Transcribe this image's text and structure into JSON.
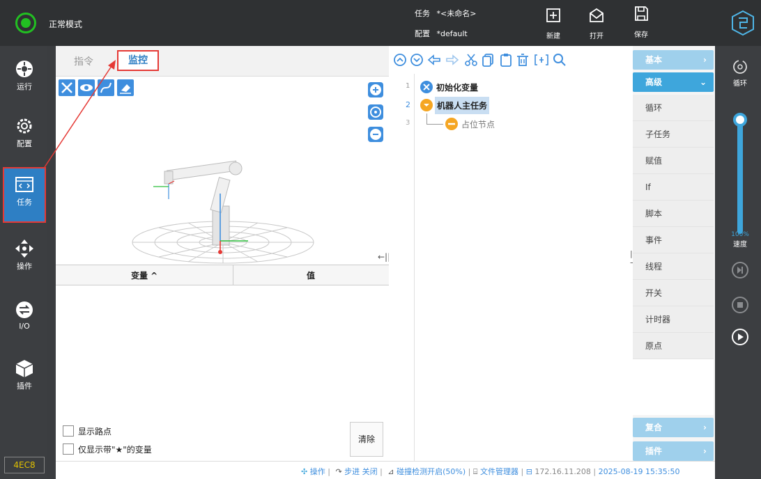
{
  "topbar": {
    "mode_label": "正常模式",
    "task_label": "任务",
    "task_name": "*<未命名>",
    "config_label": "配置",
    "config_name": "*default",
    "new_label": "新建",
    "open_label": "打开",
    "save_label": "保存"
  },
  "sidebar": {
    "items": [
      {
        "label": "运行"
      },
      {
        "label": "配置"
      },
      {
        "label": "任务"
      },
      {
        "label": "操作"
      },
      {
        "label": "I/O"
      },
      {
        "label": "插件"
      }
    ],
    "device_id": "4EC8"
  },
  "left_panel": {
    "tabs": [
      "指令",
      "监控"
    ],
    "var_table": {
      "col_variable": "变量 ^",
      "col_value": "值"
    },
    "show_waypoints": "显示路点",
    "only_starred": "仅显示带\"★\"的变量",
    "clear_button": "清除"
  },
  "tree": {
    "nodes": [
      {
        "line": "1",
        "label": "初始化变量"
      },
      {
        "line": "2",
        "label": "机器人主任务"
      },
      {
        "line": "3",
        "label": "占位节点"
      }
    ]
  },
  "commands": {
    "basic": "基本",
    "advanced": "高级",
    "items": [
      "循环",
      "子任务",
      "赋值",
      "If",
      "脚本",
      "事件",
      "线程",
      "开关",
      "计时器",
      "原点"
    ],
    "composite": "复合",
    "plugin": "插件"
  },
  "rightbar": {
    "loop_label": "循环",
    "speed_value": "100%",
    "speed_label": "速度"
  },
  "statusbar": {
    "operation": "操作",
    "step": "步进 关闭",
    "collision": "碰撞检测开启(50%)",
    "file_manager": "文件管理器",
    "ip": "172.16.11.208",
    "datetime": "2025-08-19 15:35:50"
  },
  "colors": {
    "accent": "#3ea6dc",
    "highlight": "#e53935",
    "status_green": "#22c022"
  }
}
